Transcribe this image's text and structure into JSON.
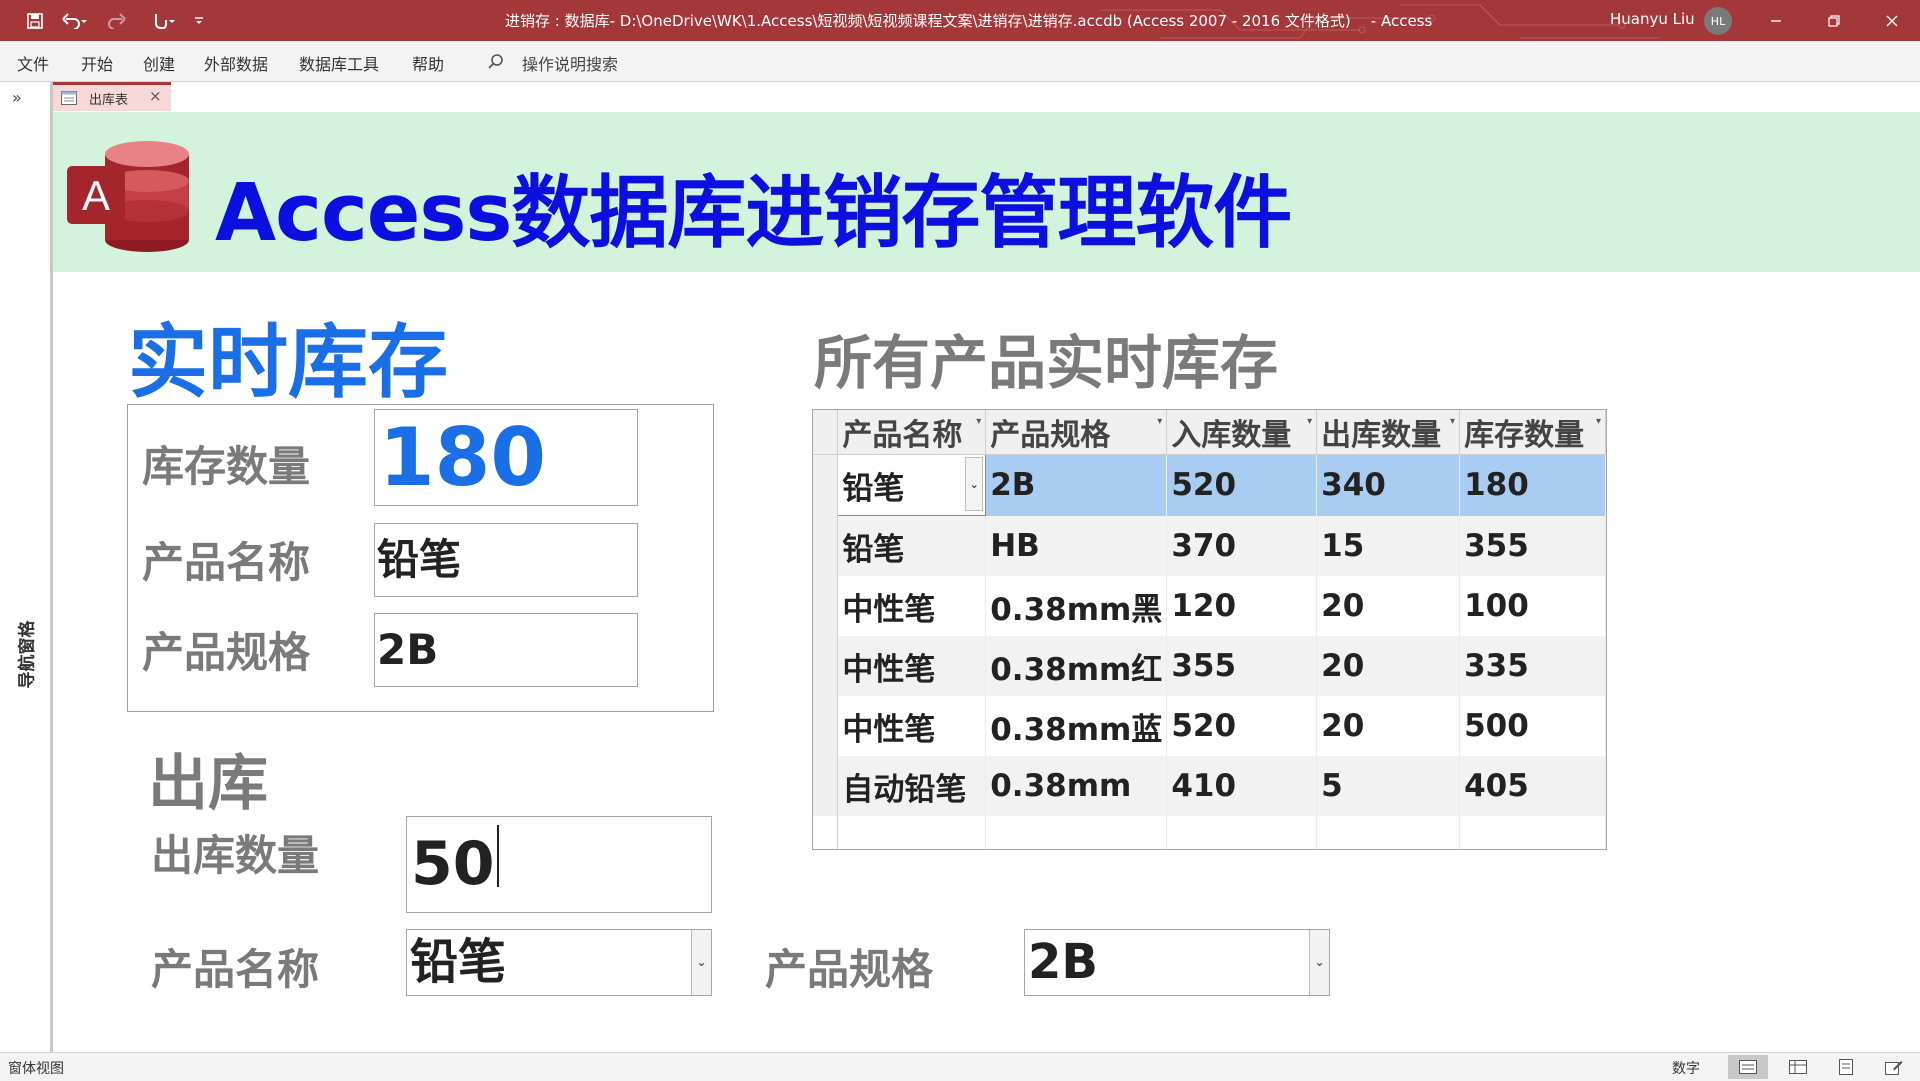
{
  "titlebar": {
    "title": "进销存 : 数据库- D:\\OneDrive\\WK\\1.Access\\短视频\\短视频课程文案\\进销存\\进销存.accdb (Access 2007 - 2016 文件格式)",
    "app": "-  Access",
    "user": "Huanyu Liu",
    "avatar_initials": "HL"
  },
  "menu": {
    "items": [
      "文件",
      "开始",
      "创建",
      "外部数据",
      "数据库工具",
      "帮助"
    ],
    "search_placeholder": "操作说明搜索"
  },
  "nav": {
    "toggle": "»",
    "label": "导航窗格"
  },
  "tab": {
    "label": "出库表",
    "close": "×"
  },
  "header": {
    "logo_letter": "A",
    "title": "Access数据库进销存管理软件"
  },
  "realtime": {
    "title": "实时库存",
    "stock_label": "库存数量",
    "stock_value": "180",
    "name_label": "产品名称",
    "name_value": "铅笔",
    "spec_label": "产品规格",
    "spec_value": "2B"
  },
  "outbound": {
    "title": "出库",
    "qty_label": "出库数量",
    "qty_value": "50",
    "name_label": "产品名称",
    "name_value": "铅笔",
    "spec_label": "产品规格",
    "spec_value": "2B"
  },
  "all_stock": {
    "title": "所有产品实时库存",
    "columns": [
      "产品名称",
      "产品规格",
      "入库数量",
      "出库数量",
      "库存数量"
    ],
    "rows": [
      [
        "铅笔",
        "2B",
        "520",
        "340",
        "180"
      ],
      [
        "铅笔",
        "HB",
        "370",
        "15",
        "355"
      ],
      [
        "中性笔",
        "0.38mm黑",
        "120",
        "20",
        "100"
      ],
      [
        "中性笔",
        "0.38mm红",
        "355",
        "20",
        "335"
      ],
      [
        "中性笔",
        "0.38mm蓝",
        "520",
        "20",
        "500"
      ],
      [
        "自动铅笔",
        "0.38mm",
        "410",
        "5",
        "405"
      ]
    ]
  },
  "status": {
    "left": "窗体视图",
    "mode": "数字"
  },
  "colors": {
    "titlebar": "#a4373a",
    "header_bg": "#d3f3dd",
    "header_title": "#0b10e0",
    "realtime_title": "#1a6ee6",
    "stock_value": "#1a6ee6",
    "selected_row": "#a9cdf2"
  }
}
